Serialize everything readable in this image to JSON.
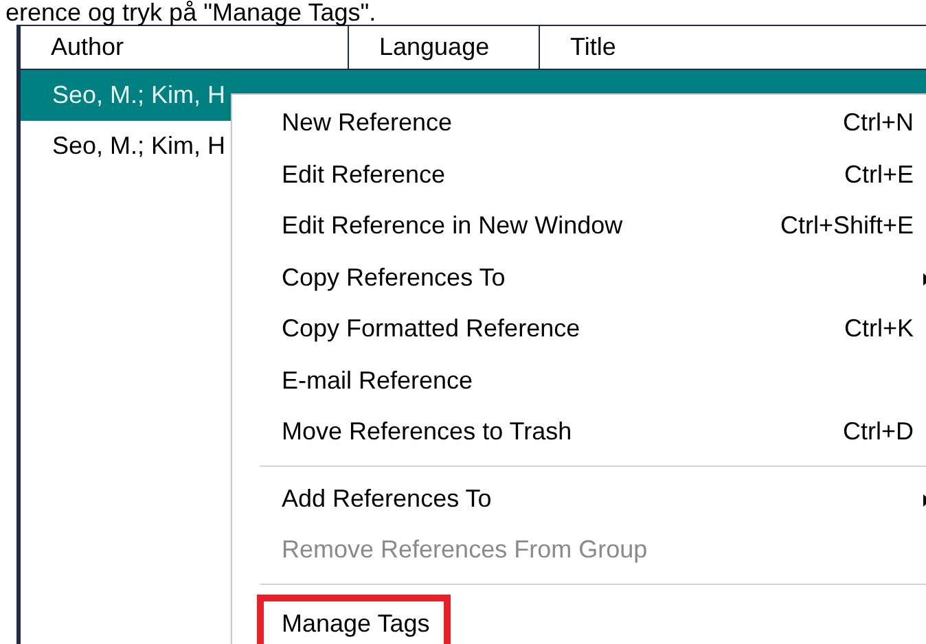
{
  "caption": "erence og tryk på \"Manage Tags\".",
  "table": {
    "columns": [
      "Author",
      "Language",
      "Title"
    ],
    "rows": [
      {
        "author": "Seo, M.; Kim, H",
        "selected": true
      },
      {
        "author": "Seo, M.; Kim, H",
        "selected": false
      }
    ]
  },
  "context_menu": {
    "items": [
      {
        "kind": "item",
        "label": "New Reference",
        "shortcut": "Ctrl+N"
      },
      {
        "kind": "item",
        "label": "Edit Reference",
        "shortcut": "Ctrl+E"
      },
      {
        "kind": "item",
        "label": "Edit Reference in New Window",
        "shortcut": "Ctrl+Shift+E"
      },
      {
        "kind": "item",
        "label": "Copy References To",
        "submenu": true
      },
      {
        "kind": "item",
        "label": "Copy Formatted Reference",
        "shortcut": "Ctrl+K"
      },
      {
        "kind": "item",
        "label": "E-mail Reference"
      },
      {
        "kind": "item",
        "label": "Move References to Trash",
        "shortcut": "Ctrl+D"
      },
      {
        "kind": "separator"
      },
      {
        "kind": "item",
        "label": "Add References To",
        "submenu": true
      },
      {
        "kind": "item",
        "label": "Remove References From Group",
        "disabled": true
      },
      {
        "kind": "separator"
      },
      {
        "kind": "item",
        "label": "Manage Tags",
        "highlighted": true
      }
    ]
  }
}
